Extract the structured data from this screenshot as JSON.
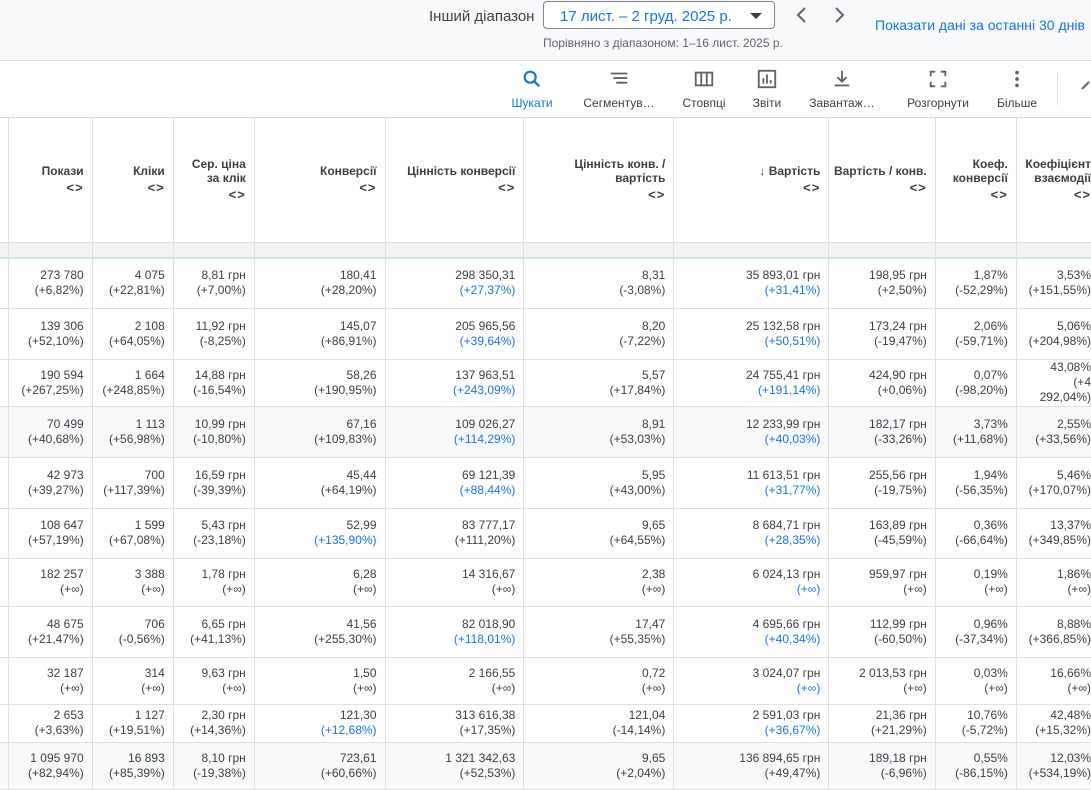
{
  "header": {
    "range_label": "Інший діапазон",
    "date_range": "17 лист. – 2 груд. 2025 р.",
    "compare_text": "Порівняно з діапазоном: 1–16 лист. 2025 р.",
    "show_link": "Показати дані за останні 30 днів"
  },
  "toolbar": {
    "search": "Шукати",
    "segment": "Сегментув…",
    "columns": "Стовпці",
    "reports": "Звіти",
    "download": "Завантаж…",
    "expand": "Розгорнути",
    "more": "Більше",
    "accent": "#1a73e8"
  },
  "columns": [
    {
      "title": "Покази"
    },
    {
      "title": "Кліки"
    },
    {
      "title": "Сер. ціна за клік"
    },
    {
      "title": "Конверсії"
    },
    {
      "title": "Цінність конверсії"
    },
    {
      "title": "Цінність конв. / вартість"
    },
    {
      "title": "Вартість",
      "sorted": "desc"
    },
    {
      "title": "Вартість / конв."
    },
    {
      "title": "Коеф. конверсії"
    },
    {
      "title": "Коефіцієнт взаємодії"
    }
  ],
  "sort_symbol": "<>",
  "rows": [
    {
      "cells": [
        [
          "273 780",
          "(+6,82%)"
        ],
        [
          "4 075",
          "(+22,81%)"
        ],
        [
          "8,81 грн",
          "(+7,00%)"
        ],
        [
          "180,41",
          "(+28,20%)"
        ],
        [
          "298 350,31",
          "(+27,37%)"
        ],
        [
          "8,31",
          "(-3,08%)"
        ],
        [
          "35 893,01 грн",
          "(+31,41%)"
        ],
        [
          "198,95 грн",
          "(+2,50%)"
        ],
        [
          "1,87%",
          "(-52,29%)"
        ],
        [
          "3,53%",
          "(+151,55%)"
        ]
      ],
      "blue": [
        4,
        6
      ]
    },
    {
      "cells": [
        [
          "139 306",
          "(+52,10%)"
        ],
        [
          "2 108",
          "(+64,05%)"
        ],
        [
          "11,92 грн",
          "(-8,25%)"
        ],
        [
          "145,07",
          "(+86,91%)"
        ],
        [
          "205 965,56",
          "(+39,64%)"
        ],
        [
          "8,20",
          "(-7,22%)"
        ],
        [
          "25 132,58 грн",
          "(+50,51%)"
        ],
        [
          "173,24 грн",
          "(-19,47%)"
        ],
        [
          "2,06%",
          "(-59,71%)"
        ],
        [
          "5,06%",
          "(+204,98%)"
        ]
      ],
      "blue": [
        4,
        6
      ]
    },
    {
      "cells": [
        [
          "190 594",
          "(+267,25%)"
        ],
        [
          "1 664",
          "(+248,85%)"
        ],
        [
          "14,88 грн",
          "(-16,54%)"
        ],
        [
          "58,26",
          "(+190,95%)"
        ],
        [
          "137 963,51",
          "(+243,09%)"
        ],
        [
          "5,57",
          "(+17,84%)"
        ],
        [
          "24 755,41 грн",
          "(+191,14%)"
        ],
        [
          "424,90 грн",
          "(+0,06%)"
        ],
        [
          "0,07%",
          "(-98,20%)"
        ],
        [
          "43,08%",
          "(+4 292,04%)"
        ]
      ],
      "blue": [
        4,
        6
      ]
    },
    {
      "cells": [
        [
          "70 499",
          "(+40,68%)"
        ],
        [
          "1 113",
          "(+56,98%)"
        ],
        [
          "10,99 грн",
          "(-10,80%)"
        ],
        [
          "67,16",
          "(+109,83%)"
        ],
        [
          "109 026,27",
          "(+114,29%)"
        ],
        [
          "8,91",
          "(+53,03%)"
        ],
        [
          "12 233,99 грн",
          "(+40,03%)"
        ],
        [
          "182,17 грн",
          "(-33,26%)"
        ],
        [
          "3,73%",
          "(+11,68%)"
        ],
        [
          "2,55%",
          "(+33,56%)"
        ]
      ],
      "blue": [
        4,
        6
      ],
      "highlight": true
    },
    {
      "cells": [
        [
          "42 973",
          "(+39,27%)"
        ],
        [
          "700",
          "(+117,39%)"
        ],
        [
          "16,59 грн",
          "(-39,39%)"
        ],
        [
          "45,44",
          "(+64,19%)"
        ],
        [
          "69 121,39",
          "(+88,44%)"
        ],
        [
          "5,95",
          "(+43,00%)"
        ],
        [
          "11 613,51 грн",
          "(+31,77%)"
        ],
        [
          "255,56 грн",
          "(-19,75%)"
        ],
        [
          "1,94%",
          "(-56,35%)"
        ],
        [
          "5,46%",
          "(+170,07%)"
        ]
      ],
      "blue": [
        4,
        6
      ]
    },
    {
      "cells": [
        [
          "108 647",
          "(+57,19%)"
        ],
        [
          "1 599",
          "(+67,08%)"
        ],
        [
          "5,43 грн",
          "(-23,18%)"
        ],
        [
          "52,99",
          "(+135,90%)"
        ],
        [
          "83 777,17",
          "(+111,20%)"
        ],
        [
          "9,65",
          "(+64,55%)"
        ],
        [
          "8 684,71 грн",
          "(+28,35%)"
        ],
        [
          "163,89 грн",
          "(-45,59%)"
        ],
        [
          "0,36%",
          "(-66,64%)"
        ],
        [
          "13,37%",
          "(+349,85%)"
        ]
      ],
      "blue": [
        3,
        6
      ]
    },
    {
      "cells": [
        [
          "182 257",
          "(+∞)"
        ],
        [
          "3 388",
          "(+∞)"
        ],
        [
          "1,78 грн",
          "(+∞)"
        ],
        [
          "6,28",
          "(+∞)"
        ],
        [
          "14 316,67",
          "(+∞)"
        ],
        [
          "2,38",
          "(+∞)"
        ],
        [
          "6 024,13 грн",
          "(+∞)"
        ],
        [
          "959,97 грн",
          "(+∞)"
        ],
        [
          "0,19%",
          "(+∞)"
        ],
        [
          "1,86%",
          "(+∞)"
        ]
      ],
      "blue": [
        6
      ]
    },
    {
      "cells": [
        [
          "48 675",
          "(+21,47%)"
        ],
        [
          "706",
          "(-0,56%)"
        ],
        [
          "6,65 грн",
          "(+41,13%)"
        ],
        [
          "41,56",
          "(+255,30%)"
        ],
        [
          "82 018,90",
          "(+118,01%)"
        ],
        [
          "17,47",
          "(+55,35%)"
        ],
        [
          "4 695,66 грн",
          "(+40,34%)"
        ],
        [
          "112,99 грн",
          "(-60,50%)"
        ],
        [
          "0,96%",
          "(-37,34%)"
        ],
        [
          "8,88%",
          "(+366,85%)"
        ]
      ],
      "blue": [
        4,
        6
      ]
    },
    {
      "cells": [
        [
          "32 187",
          "(+∞)"
        ],
        [
          "314",
          "(+∞)"
        ],
        [
          "9,63 грн",
          "(+∞)"
        ],
        [
          "1,50",
          "(+∞)"
        ],
        [
          "2 166,55",
          "(+∞)"
        ],
        [
          "0,72",
          "(+∞)"
        ],
        [
          "3 024,07 грн",
          "(+∞)"
        ],
        [
          "2 013,53 грн",
          "(+∞)"
        ],
        [
          "0,03%",
          "(+∞)"
        ],
        [
          "16,66%",
          "(+∞)"
        ]
      ],
      "blue": [
        6
      ]
    },
    {
      "cells": [
        [
          "2 653",
          "(+3,63%)"
        ],
        [
          "1 127",
          "(+19,51%)"
        ],
        [
          "2,30 грн",
          "(+14,36%)"
        ],
        [
          "121,30",
          "(+12,68%)"
        ],
        [
          "313 616,38",
          "(+17,35%)"
        ],
        [
          "121,04",
          "(-14,14%)"
        ],
        [
          "2 591,03 грн",
          "(+36,67%)"
        ],
        [
          "21,36 грн",
          "(+21,29%)"
        ],
        [
          "10,76%",
          "(-5,72%)"
        ],
        [
          "42,48%",
          "(+15,32%)"
        ]
      ],
      "blue": [
        3,
        6
      ]
    },
    {
      "cells": [
        [
          "1 095 970",
          "(+82,94%)"
        ],
        [
          "16 893",
          "(+85,39%)"
        ],
        [
          "8,10 грн",
          "(-19,38%)"
        ],
        [
          "723,61",
          "(+60,66%)"
        ],
        [
          "1 321 342,63",
          "(+52,53%)"
        ],
        [
          "9,65",
          "(+2,04%)"
        ],
        [
          "136 894,65 грн",
          "(+49,47%)"
        ],
        [
          "189,18 грн",
          "(-6,96%)"
        ],
        [
          "0,55%",
          "(-86,15%)"
        ],
        [
          "12,03%",
          "(+534,19%)"
        ]
      ],
      "blue": [],
      "highlight": true
    }
  ]
}
